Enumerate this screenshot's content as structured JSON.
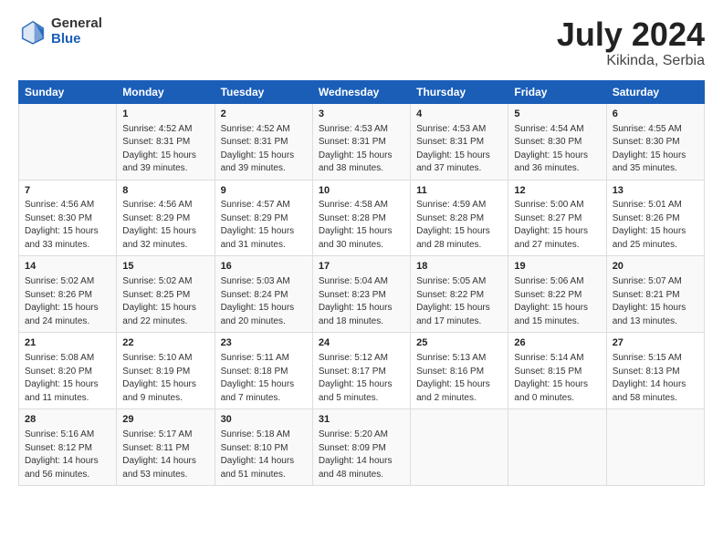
{
  "header": {
    "logo_general": "General",
    "logo_blue": "Blue",
    "title": "July 2024",
    "subtitle": "Kikinda, Serbia"
  },
  "days_of_week": [
    "Sunday",
    "Monday",
    "Tuesday",
    "Wednesday",
    "Thursday",
    "Friday",
    "Saturday"
  ],
  "weeks": [
    [
      {
        "day": "",
        "info": ""
      },
      {
        "day": "1",
        "info": "Sunrise: 4:52 AM\nSunset: 8:31 PM\nDaylight: 15 hours\nand 39 minutes."
      },
      {
        "day": "2",
        "info": "Sunrise: 4:52 AM\nSunset: 8:31 PM\nDaylight: 15 hours\nand 39 minutes."
      },
      {
        "day": "3",
        "info": "Sunrise: 4:53 AM\nSunset: 8:31 PM\nDaylight: 15 hours\nand 38 minutes."
      },
      {
        "day": "4",
        "info": "Sunrise: 4:53 AM\nSunset: 8:31 PM\nDaylight: 15 hours\nand 37 minutes."
      },
      {
        "day": "5",
        "info": "Sunrise: 4:54 AM\nSunset: 8:30 PM\nDaylight: 15 hours\nand 36 minutes."
      },
      {
        "day": "6",
        "info": "Sunrise: 4:55 AM\nSunset: 8:30 PM\nDaylight: 15 hours\nand 35 minutes."
      }
    ],
    [
      {
        "day": "7",
        "info": "Sunrise: 4:56 AM\nSunset: 8:30 PM\nDaylight: 15 hours\nand 33 minutes."
      },
      {
        "day": "8",
        "info": "Sunrise: 4:56 AM\nSunset: 8:29 PM\nDaylight: 15 hours\nand 32 minutes."
      },
      {
        "day": "9",
        "info": "Sunrise: 4:57 AM\nSunset: 8:29 PM\nDaylight: 15 hours\nand 31 minutes."
      },
      {
        "day": "10",
        "info": "Sunrise: 4:58 AM\nSunset: 8:28 PM\nDaylight: 15 hours\nand 30 minutes."
      },
      {
        "day": "11",
        "info": "Sunrise: 4:59 AM\nSunset: 8:28 PM\nDaylight: 15 hours\nand 28 minutes."
      },
      {
        "day": "12",
        "info": "Sunrise: 5:00 AM\nSunset: 8:27 PM\nDaylight: 15 hours\nand 27 minutes."
      },
      {
        "day": "13",
        "info": "Sunrise: 5:01 AM\nSunset: 8:26 PM\nDaylight: 15 hours\nand 25 minutes."
      }
    ],
    [
      {
        "day": "14",
        "info": "Sunrise: 5:02 AM\nSunset: 8:26 PM\nDaylight: 15 hours\nand 24 minutes."
      },
      {
        "day": "15",
        "info": "Sunrise: 5:02 AM\nSunset: 8:25 PM\nDaylight: 15 hours\nand 22 minutes."
      },
      {
        "day": "16",
        "info": "Sunrise: 5:03 AM\nSunset: 8:24 PM\nDaylight: 15 hours\nand 20 minutes."
      },
      {
        "day": "17",
        "info": "Sunrise: 5:04 AM\nSunset: 8:23 PM\nDaylight: 15 hours\nand 18 minutes."
      },
      {
        "day": "18",
        "info": "Sunrise: 5:05 AM\nSunset: 8:22 PM\nDaylight: 15 hours\nand 17 minutes."
      },
      {
        "day": "19",
        "info": "Sunrise: 5:06 AM\nSunset: 8:22 PM\nDaylight: 15 hours\nand 15 minutes."
      },
      {
        "day": "20",
        "info": "Sunrise: 5:07 AM\nSunset: 8:21 PM\nDaylight: 15 hours\nand 13 minutes."
      }
    ],
    [
      {
        "day": "21",
        "info": "Sunrise: 5:08 AM\nSunset: 8:20 PM\nDaylight: 15 hours\nand 11 minutes."
      },
      {
        "day": "22",
        "info": "Sunrise: 5:10 AM\nSunset: 8:19 PM\nDaylight: 15 hours\nand 9 minutes."
      },
      {
        "day": "23",
        "info": "Sunrise: 5:11 AM\nSunset: 8:18 PM\nDaylight: 15 hours\nand 7 minutes."
      },
      {
        "day": "24",
        "info": "Sunrise: 5:12 AM\nSunset: 8:17 PM\nDaylight: 15 hours\nand 5 minutes."
      },
      {
        "day": "25",
        "info": "Sunrise: 5:13 AM\nSunset: 8:16 PM\nDaylight: 15 hours\nand 2 minutes."
      },
      {
        "day": "26",
        "info": "Sunrise: 5:14 AM\nSunset: 8:15 PM\nDaylight: 15 hours\nand 0 minutes."
      },
      {
        "day": "27",
        "info": "Sunrise: 5:15 AM\nSunset: 8:13 PM\nDaylight: 14 hours\nand 58 minutes."
      }
    ],
    [
      {
        "day": "28",
        "info": "Sunrise: 5:16 AM\nSunset: 8:12 PM\nDaylight: 14 hours\nand 56 minutes."
      },
      {
        "day": "29",
        "info": "Sunrise: 5:17 AM\nSunset: 8:11 PM\nDaylight: 14 hours\nand 53 minutes."
      },
      {
        "day": "30",
        "info": "Sunrise: 5:18 AM\nSunset: 8:10 PM\nDaylight: 14 hours\nand 51 minutes."
      },
      {
        "day": "31",
        "info": "Sunrise: 5:20 AM\nSunset: 8:09 PM\nDaylight: 14 hours\nand 48 minutes."
      },
      {
        "day": "",
        "info": ""
      },
      {
        "day": "",
        "info": ""
      },
      {
        "day": "",
        "info": ""
      }
    ]
  ]
}
